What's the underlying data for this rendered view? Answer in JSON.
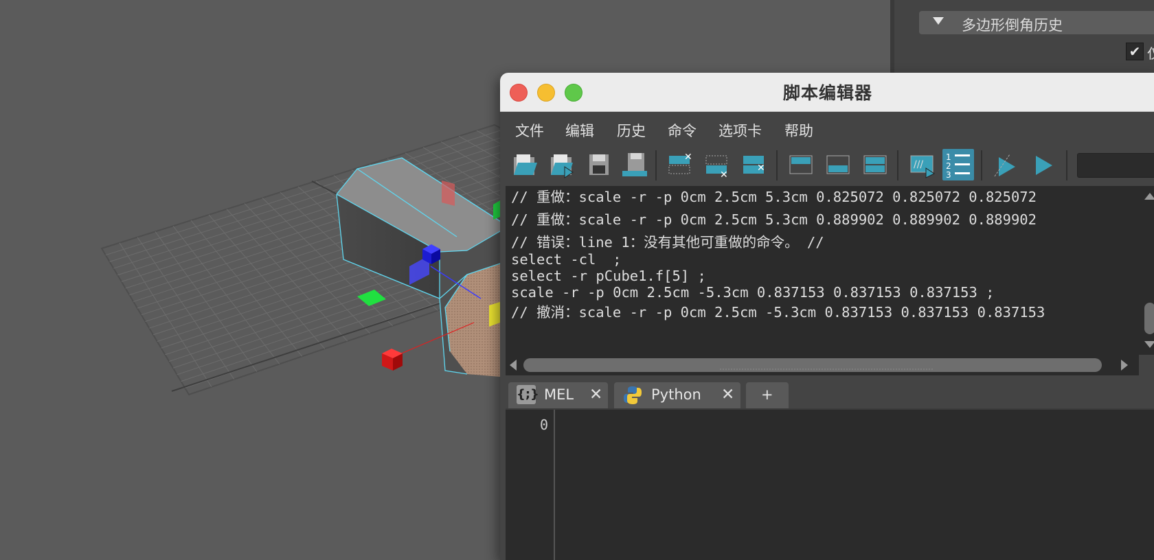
{
  "attribute_editor": {
    "section_title": "多边形倒角历史",
    "checkbox_label": "仅"
  },
  "script_editor": {
    "title": "脚本编辑器",
    "menu": [
      "文件",
      "编辑",
      "历史",
      "命令",
      "选项卡",
      "帮助"
    ],
    "toolbar_icons": [
      "load-script-icon",
      "source-script-icon",
      "save-script-icon",
      "save-to-shelf-icon",
      "clear-history-icon",
      "clear-input-icon",
      "clear-all-icon",
      "show-history-icon",
      "show-input-icon",
      "show-both-icon",
      "echo-all-commands-icon",
      "show-line-numbers-icon",
      "execute-selected-icon",
      "execute-all-icon"
    ],
    "history_lines": [
      "// 重做：scale -r -p 0cm 2.5cm 5.3cm 0.825072 0.825072 0.825072",
      "// 重做：scale -r -p 0cm 2.5cm 5.3cm 0.889902 0.889902 0.889902",
      "// 错误：line 1：没有其他可重做的命令。 //",
      "select -cl  ;",
      "select -r pCube1.f[5] ;",
      "scale -r -p 0cm 2.5cm -5.3cm 0.837153 0.837153 0.837153 ;",
      "// 撤消：scale -r -p 0cm 2.5cm -5.3cm 0.837153 0.837153 0.837153"
    ],
    "tabs": [
      {
        "label": "MEL",
        "icon_text": "{;}"
      },
      {
        "label": "Python"
      }
    ],
    "tab_close": "✕",
    "add_tab": "+",
    "line_number": "0"
  },
  "colors": {
    "viewport_bg": "#5b5b5b",
    "panel_bg": "#444444",
    "editor_bg": "#2b2b2b",
    "toolbar_accent": "#3aa0b8",
    "selection_wire": "#5fd7f0"
  }
}
